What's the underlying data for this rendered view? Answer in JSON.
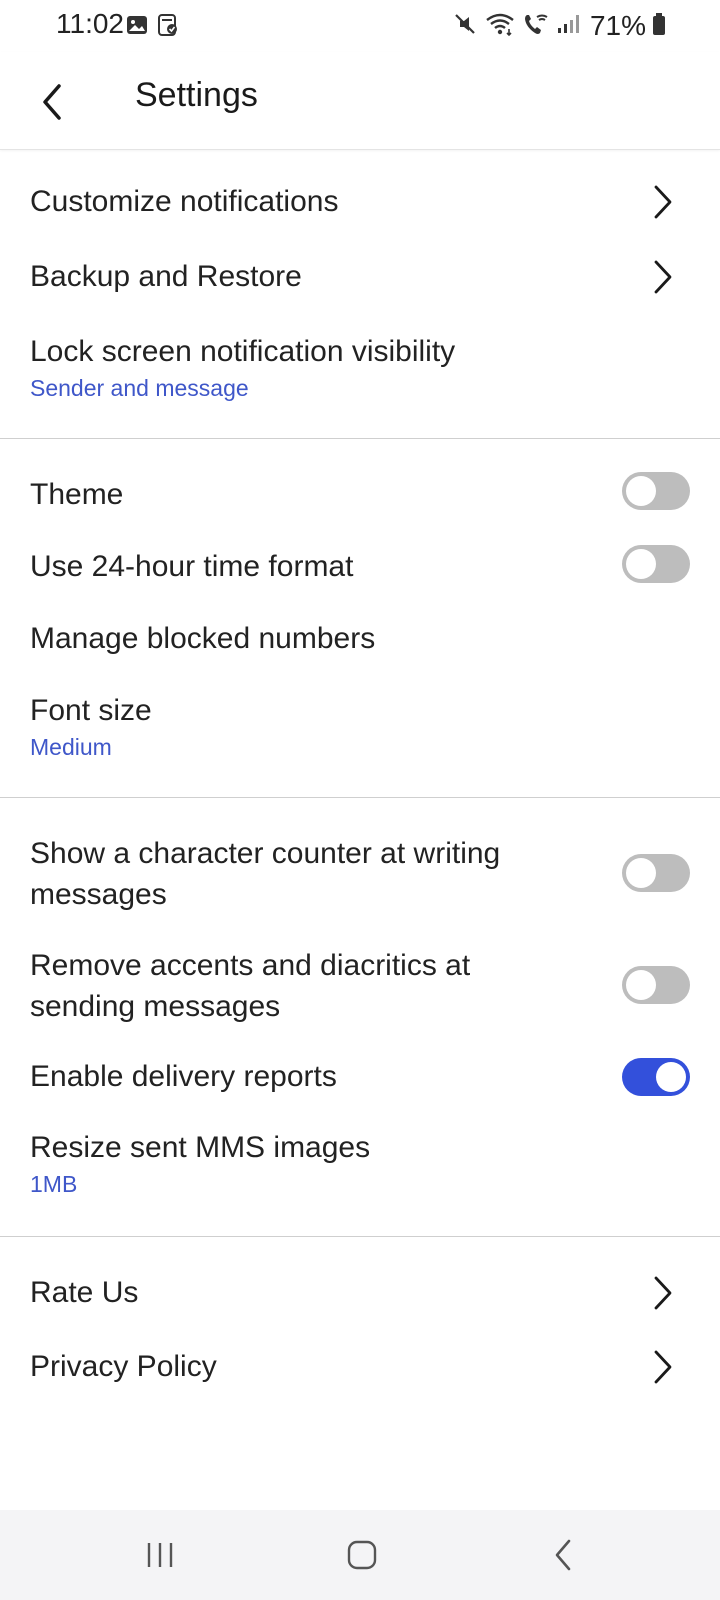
{
  "status_bar": {
    "time": "11:02",
    "left_icons": [
      "image-icon",
      "sim-card-check-icon"
    ],
    "right_icons": [
      "mute-icon",
      "wifi-icon",
      "wifi-call-icon",
      "signal-icon",
      "battery-icon"
    ],
    "battery": "71%"
  },
  "app_bar": {
    "title": "Settings"
  },
  "section1": {
    "customize": {
      "label": "Customize notifications"
    },
    "backup": {
      "label": "Backup and Restore"
    },
    "lock_screen": {
      "label": "Lock screen notification visibility",
      "value": "Sender and message"
    }
  },
  "section2": {
    "theme": {
      "label": "Theme",
      "toggle": false
    },
    "time_format": {
      "label": "Use 24-hour time format",
      "toggle": false
    },
    "blocked": {
      "label": "Manage blocked numbers"
    },
    "font_size": {
      "label": "Font size",
      "value": "Medium"
    }
  },
  "section3": {
    "char_counter": {
      "label_line1": "Show a character counter at writing",
      "label_line2": "messages",
      "toggle": false
    },
    "accents": {
      "label_line1": "Remove accents and diacritics at",
      "label_line2": "sending messages",
      "toggle": false
    },
    "delivery": {
      "label": "Enable delivery reports",
      "toggle": true
    },
    "resize_mms": {
      "label": "Resize sent MMS images",
      "value": "1MB"
    }
  },
  "section4": {
    "rate": {
      "label": "Rate Us"
    },
    "privacy": {
      "label": "Privacy Policy"
    }
  },
  "colors": {
    "accent": "#3350db",
    "subtitle": "#3f57c9",
    "toggle_off": "#bdbdbd",
    "divider": "#cfcfcf"
  },
  "nav_bar": {
    "buttons": [
      "recents-icon",
      "home-icon",
      "back-icon"
    ]
  }
}
